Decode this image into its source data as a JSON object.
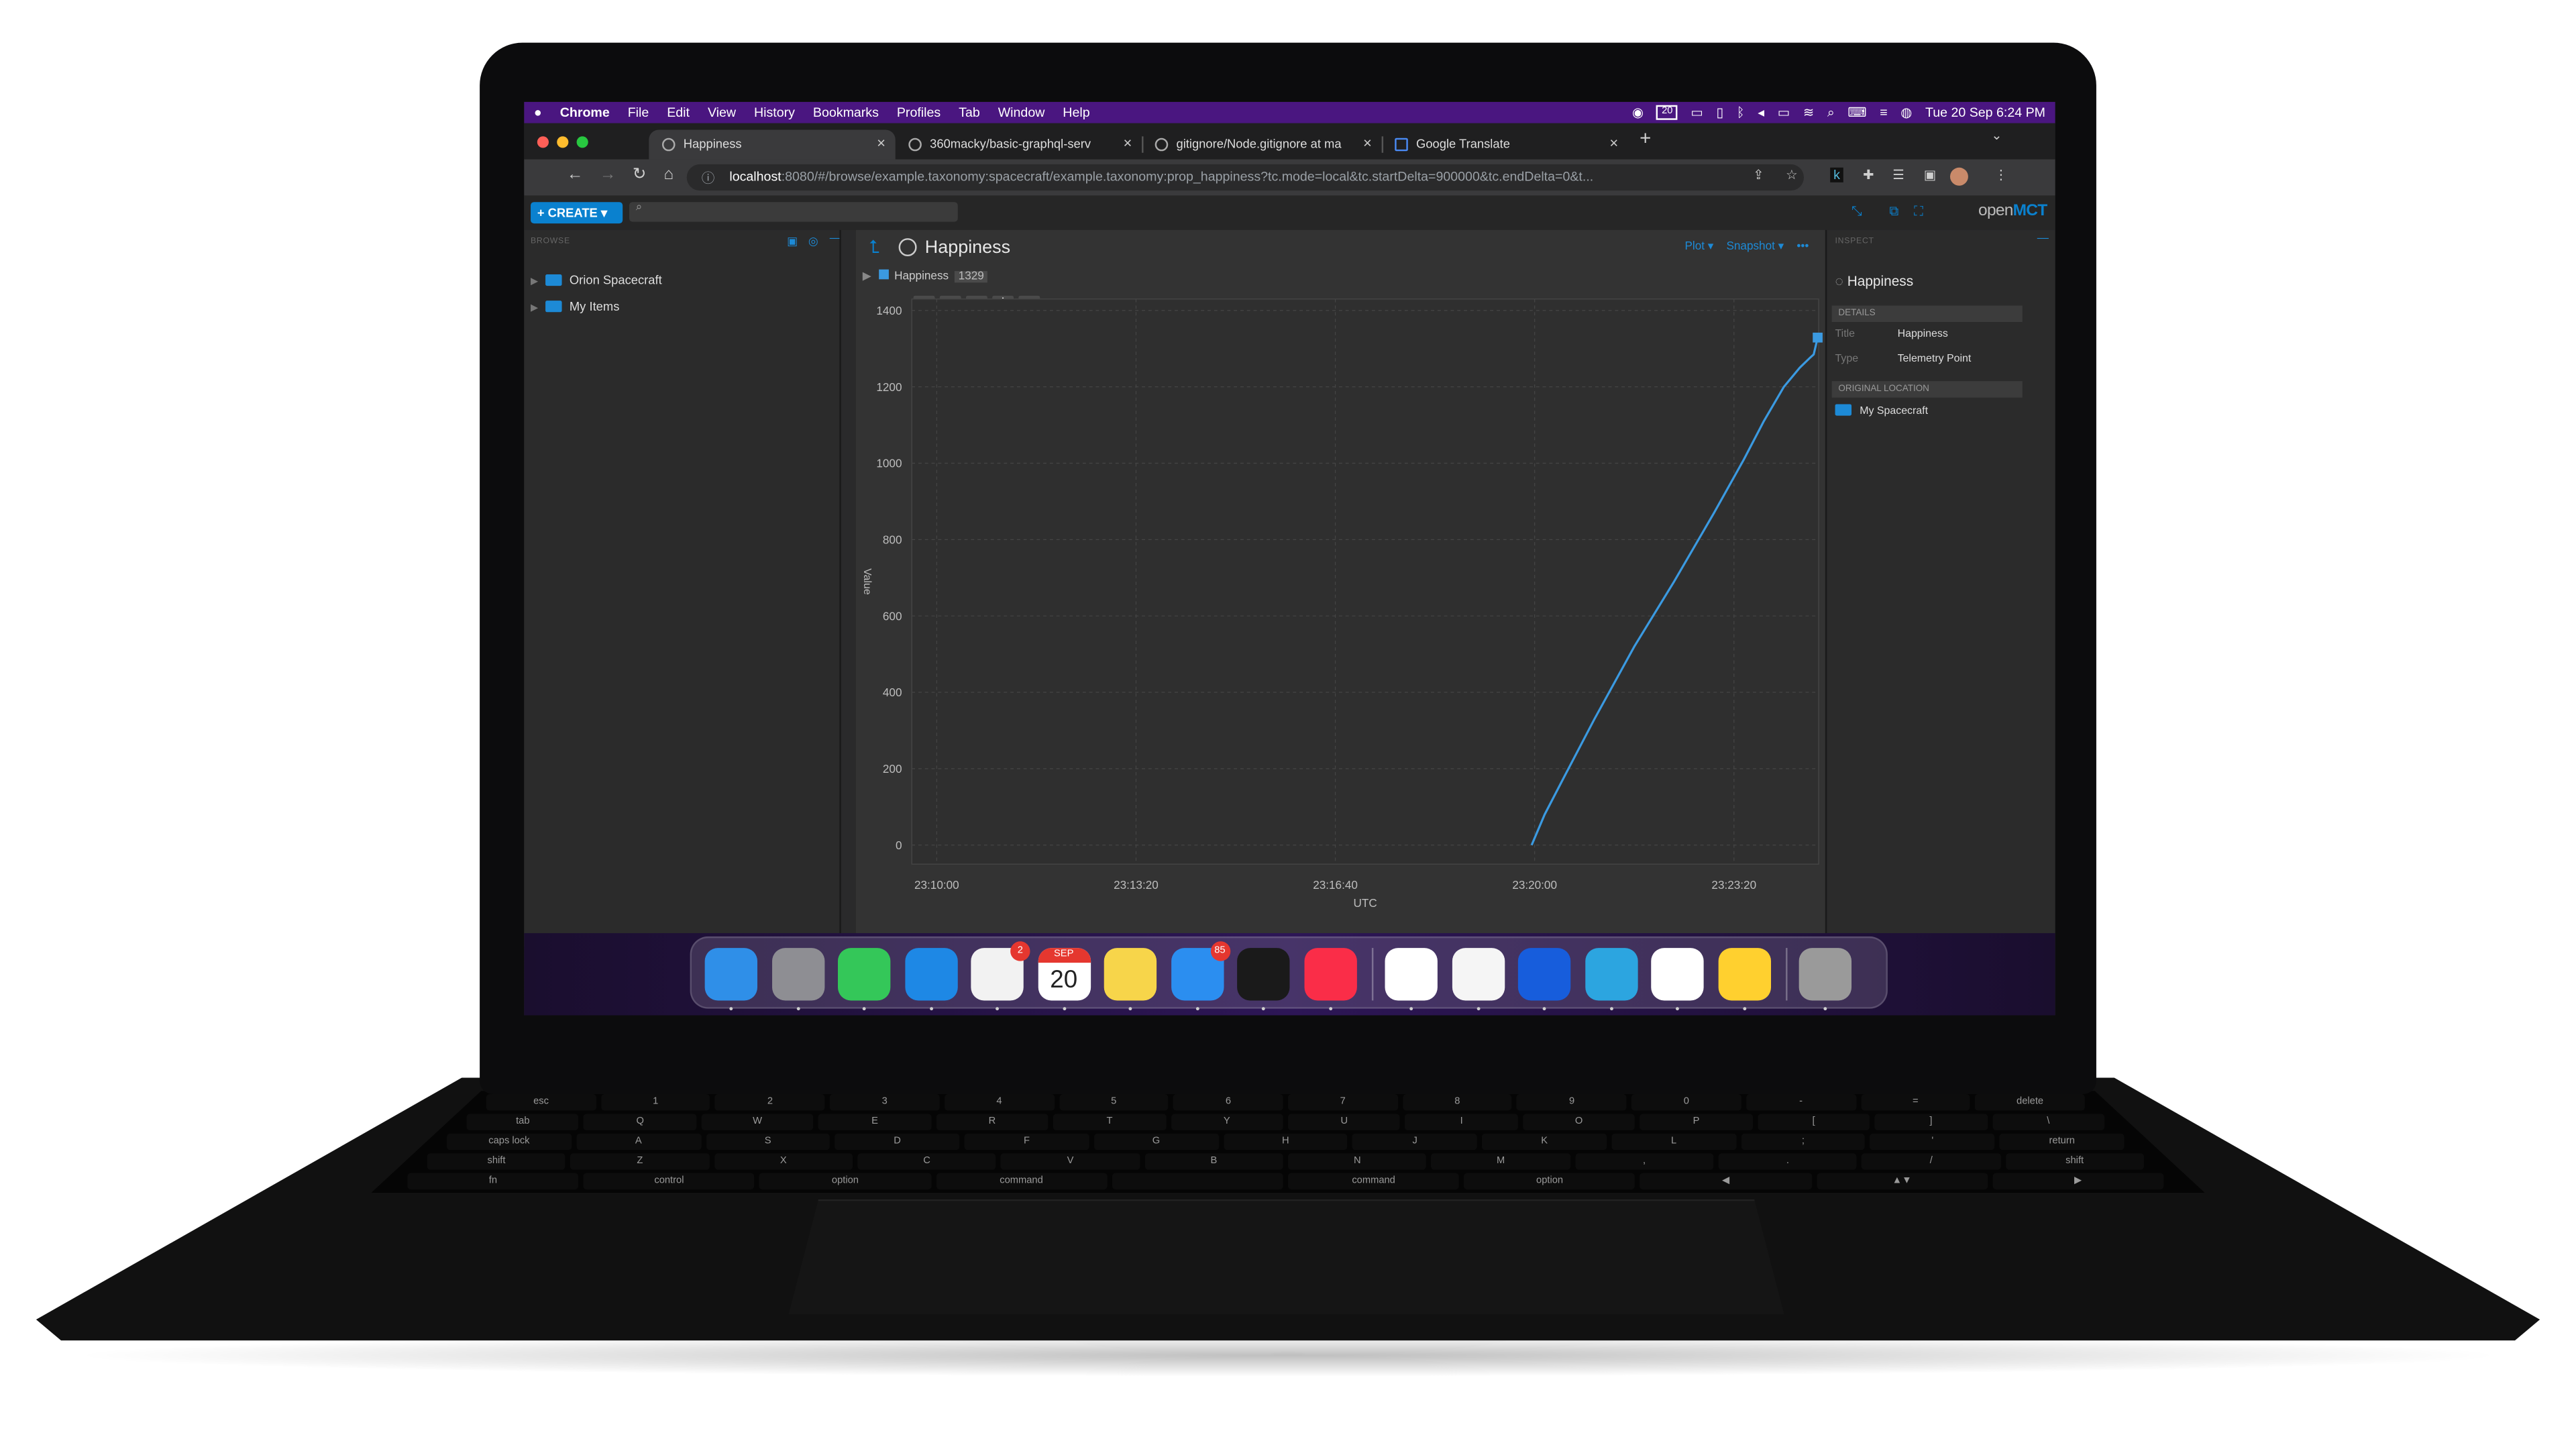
{
  "menubar": {
    "apple": "",
    "app_name": "Chrome",
    "items": [
      "File",
      "Edit",
      "View",
      "History",
      "Bookmarks",
      "Profiles",
      "Tab",
      "Window",
      "Help"
    ],
    "status_count": "20",
    "datetime": "Tue 20 Sep  6:24 PM"
  },
  "tabs": [
    {
      "title": "Happiness",
      "active": true
    },
    {
      "title": "360macky/basic-graphql-serv"
    },
    {
      "title": "gitignore/Node.gitignore at ma"
    },
    {
      "title": "Google Translate"
    }
  ],
  "address": {
    "host": "localhost",
    "rest": ":8080/#/browse/example.taxonomy:spacecraft/example.taxonomy:prop_happiness?tc.mode=local&tc.startDelta=900000&tc.endDelta=0&t..."
  },
  "openmct": {
    "create_label": "+ CREATE ▾",
    "brand_prefix": "open",
    "brand_suffix": "MCT"
  },
  "browse": {
    "header": "BROWSE",
    "items": [
      {
        "label": "Orion Spacecraft"
      },
      {
        "label": "My Items"
      }
    ]
  },
  "view": {
    "title": "Happiness",
    "plot_button": "Plot ▾",
    "snapshot_button": "Snapshot ▾",
    "more": "•••",
    "legend_name": "Happiness",
    "legend_value": "1329"
  },
  "inspect": {
    "header": "INSPECT",
    "title": "Happiness",
    "details_header": "DETAILS",
    "title_label": "Title",
    "title_value": "Happiness",
    "type_label": "Type",
    "type_value": "Telemetry Point",
    "location_header": "ORIGINAL LOCATION",
    "location_value": "My Spacecraft"
  },
  "chart_data": {
    "type": "line",
    "ylabel": "Value",
    "xlabel": "UTC",
    "ylim": [
      -50,
      1430
    ],
    "yticks": [
      0,
      200,
      400,
      600,
      800,
      1000,
      1200,
      1400
    ],
    "xticks": [
      "23:10:00",
      "23:13:20",
      "23:16:40",
      "23:20:00",
      "23:23:20"
    ],
    "xtick_seconds": [
      0,
      200,
      400,
      600,
      800
    ],
    "xlim_seconds": [
      -25,
      885
    ],
    "grid": true,
    "series": [
      {
        "name": "Happiness",
        "color": "#3b9ae1",
        "x_seconds": [
          597,
          610,
          630,
          660,
          700,
          740,
          780,
          810,
          830,
          850,
          866,
          876,
          880,
          884
        ],
        "values": [
          0,
          80,
          180,
          330,
          520,
          690,
          870,
          1010,
          1110,
          1200,
          1250,
          1275,
          1285,
          1329
        ]
      }
    ]
  },
  "dock": {
    "apps": [
      {
        "name": "finder",
        "color": "#2f8fe8"
      },
      {
        "name": "launchpad",
        "color": "#8e8e93"
      },
      {
        "name": "messages",
        "color": "#34c759"
      },
      {
        "name": "safari",
        "color": "#1e88e5"
      },
      {
        "name": "reminders",
        "color": "#f2f2f2",
        "badge": "2"
      },
      {
        "name": "calendar",
        "color": "#ffffff",
        "month": "SEP",
        "day": "20"
      },
      {
        "name": "notes",
        "color": "#f7d54a"
      },
      {
        "name": "mail",
        "color": "#2b8ef0",
        "badge": "85"
      },
      {
        "name": "terminal",
        "color": "#1a1a1a"
      },
      {
        "name": "music",
        "color": "#fa2d48"
      },
      {
        "name": "chrome",
        "color": "#ffffff"
      },
      {
        "name": "vscode",
        "color": "#f5f5f5"
      },
      {
        "name": "bitwarden",
        "color": "#175ddc"
      },
      {
        "name": "telegram",
        "color": "#2ca5e0"
      },
      {
        "name": "notion",
        "color": "#ffffff"
      },
      {
        "name": "miro",
        "color": "#ffd02f"
      },
      {
        "name": "trash",
        "color": "#9a9a9a"
      }
    ]
  },
  "keyboard": {
    "row1": [
      "esc",
      "1",
      "2",
      "3",
      "4",
      "5",
      "6",
      "7",
      "8",
      "9",
      "0",
      "-",
      "=",
      "delete"
    ],
    "row2": [
      "tab",
      "Q",
      "W",
      "E",
      "R",
      "T",
      "Y",
      "U",
      "I",
      "O",
      "P",
      "[",
      "]",
      "\\"
    ],
    "row3": [
      "caps lock",
      "A",
      "S",
      "D",
      "F",
      "G",
      "H",
      "J",
      "K",
      "L",
      ";",
      "'",
      "return"
    ],
    "row4": [
      "shift",
      "Z",
      "X",
      "C",
      "V",
      "B",
      "N",
      "M",
      ",",
      ".",
      "/",
      "shift"
    ],
    "row5": [
      "fn",
      "control",
      "option",
      "command",
      "",
      "command",
      "option",
      "◀",
      "▲▼",
      "▶"
    ]
  }
}
